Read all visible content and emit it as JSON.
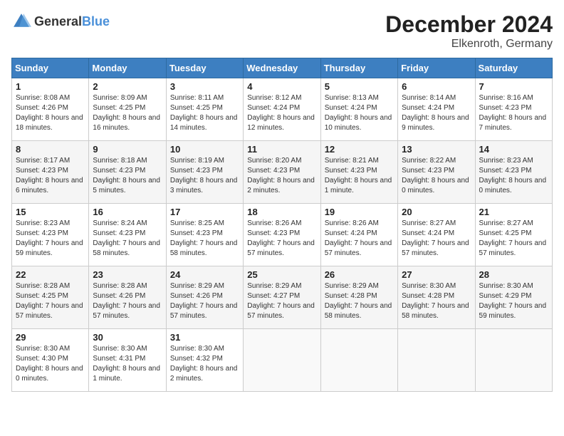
{
  "header": {
    "logo_general": "General",
    "logo_blue": "Blue",
    "month_year": "December 2024",
    "location": "Elkenroth, Germany"
  },
  "weekdays": [
    "Sunday",
    "Monday",
    "Tuesday",
    "Wednesday",
    "Thursday",
    "Friday",
    "Saturday"
  ],
  "weeks": [
    [
      {
        "day": "1",
        "sunrise": "8:08 AM",
        "sunset": "4:26 PM",
        "daylight": "8 hours and 18 minutes"
      },
      {
        "day": "2",
        "sunrise": "8:09 AM",
        "sunset": "4:25 PM",
        "daylight": "8 hours and 16 minutes"
      },
      {
        "day": "3",
        "sunrise": "8:11 AM",
        "sunset": "4:25 PM",
        "daylight": "8 hours and 14 minutes"
      },
      {
        "day": "4",
        "sunrise": "8:12 AM",
        "sunset": "4:24 PM",
        "daylight": "8 hours and 12 minutes"
      },
      {
        "day": "5",
        "sunrise": "8:13 AM",
        "sunset": "4:24 PM",
        "daylight": "8 hours and 10 minutes"
      },
      {
        "day": "6",
        "sunrise": "8:14 AM",
        "sunset": "4:24 PM",
        "daylight": "8 hours and 9 minutes"
      },
      {
        "day": "7",
        "sunrise": "8:16 AM",
        "sunset": "4:23 PM",
        "daylight": "8 hours and 7 minutes"
      }
    ],
    [
      {
        "day": "8",
        "sunrise": "8:17 AM",
        "sunset": "4:23 PM",
        "daylight": "8 hours and 6 minutes"
      },
      {
        "day": "9",
        "sunrise": "8:18 AM",
        "sunset": "4:23 PM",
        "daylight": "8 hours and 5 minutes"
      },
      {
        "day": "10",
        "sunrise": "8:19 AM",
        "sunset": "4:23 PM",
        "daylight": "8 hours and 3 minutes"
      },
      {
        "day": "11",
        "sunrise": "8:20 AM",
        "sunset": "4:23 PM",
        "daylight": "8 hours and 2 minutes"
      },
      {
        "day": "12",
        "sunrise": "8:21 AM",
        "sunset": "4:23 PM",
        "daylight": "8 hours and 1 minute"
      },
      {
        "day": "13",
        "sunrise": "8:22 AM",
        "sunset": "4:23 PM",
        "daylight": "8 hours and 0 minutes"
      },
      {
        "day": "14",
        "sunrise": "8:23 AM",
        "sunset": "4:23 PM",
        "daylight": "8 hours and 0 minutes"
      }
    ],
    [
      {
        "day": "15",
        "sunrise": "8:23 AM",
        "sunset": "4:23 PM",
        "daylight": "7 hours and 59 minutes"
      },
      {
        "day": "16",
        "sunrise": "8:24 AM",
        "sunset": "4:23 PM",
        "daylight": "7 hours and 58 minutes"
      },
      {
        "day": "17",
        "sunrise": "8:25 AM",
        "sunset": "4:23 PM",
        "daylight": "7 hours and 58 minutes"
      },
      {
        "day": "18",
        "sunrise": "8:26 AM",
        "sunset": "4:23 PM",
        "daylight": "7 hours and 57 minutes"
      },
      {
        "day": "19",
        "sunrise": "8:26 AM",
        "sunset": "4:24 PM",
        "daylight": "7 hours and 57 minutes"
      },
      {
        "day": "20",
        "sunrise": "8:27 AM",
        "sunset": "4:24 PM",
        "daylight": "7 hours and 57 minutes"
      },
      {
        "day": "21",
        "sunrise": "8:27 AM",
        "sunset": "4:25 PM",
        "daylight": "7 hours and 57 minutes"
      }
    ],
    [
      {
        "day": "22",
        "sunrise": "8:28 AM",
        "sunset": "4:25 PM",
        "daylight": "7 hours and 57 minutes"
      },
      {
        "day": "23",
        "sunrise": "8:28 AM",
        "sunset": "4:26 PM",
        "daylight": "7 hours and 57 minutes"
      },
      {
        "day": "24",
        "sunrise": "8:29 AM",
        "sunset": "4:26 PM",
        "daylight": "7 hours and 57 minutes"
      },
      {
        "day": "25",
        "sunrise": "8:29 AM",
        "sunset": "4:27 PM",
        "daylight": "7 hours and 57 minutes"
      },
      {
        "day": "26",
        "sunrise": "8:29 AM",
        "sunset": "4:28 PM",
        "daylight": "7 hours and 58 minutes"
      },
      {
        "day": "27",
        "sunrise": "8:30 AM",
        "sunset": "4:28 PM",
        "daylight": "7 hours and 58 minutes"
      },
      {
        "day": "28",
        "sunrise": "8:30 AM",
        "sunset": "4:29 PM",
        "daylight": "7 hours and 59 minutes"
      }
    ],
    [
      {
        "day": "29",
        "sunrise": "8:30 AM",
        "sunset": "4:30 PM",
        "daylight": "8 hours and 0 minutes"
      },
      {
        "day": "30",
        "sunrise": "8:30 AM",
        "sunset": "4:31 PM",
        "daylight": "8 hours and 1 minute"
      },
      {
        "day": "31",
        "sunrise": "8:30 AM",
        "sunset": "4:32 PM",
        "daylight": "8 hours and 2 minutes"
      },
      null,
      null,
      null,
      null
    ]
  ]
}
